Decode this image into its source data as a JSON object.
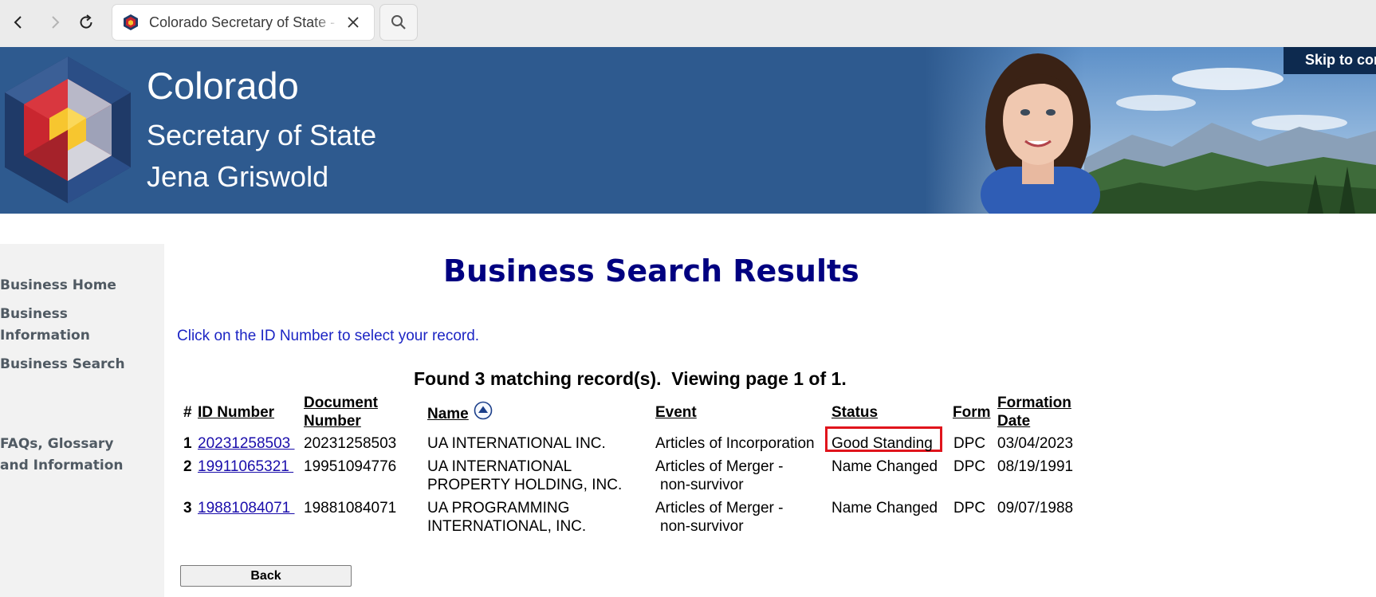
{
  "browser": {
    "tab_title": "Colorado Secretary of State - Business Search Results",
    "tab_favicon": "colorado-sos-favicon"
  },
  "banner": {
    "state": "Colorado",
    "office": "Secretary of State",
    "official": "Jena Griswold",
    "skip_link": "Skip to content",
    "colors": {
      "background": "#2e5a8f"
    }
  },
  "sidebar": {
    "items": [
      {
        "label": "Business Home"
      },
      {
        "label_line1": "Business",
        "label_line2": "Information"
      },
      {
        "label": "Business Search"
      },
      {
        "label_line1": "FAQs, Glossary",
        "label_line2": "and Information"
      }
    ]
  },
  "main": {
    "title": "Business Search Results",
    "instruction": "Click on the ID Number to select your record.",
    "summary": "Found 3 matching record(s).  Viewing page 1 of 1.",
    "table": {
      "headers": {
        "hash": "#",
        "id_number": "ID Number",
        "document_number_line1": "Document",
        "document_number_line2": "Number",
        "name": "Name",
        "event": "Event",
        "status": "Status",
        "form": "Form",
        "formation_date_line1": "Formation",
        "formation_date_line2": "Date"
      },
      "rows": [
        {
          "num": "1",
          "id": "20231258503",
          "doc": "20231258503",
          "name_line1": "UA INTERNATIONAL INC.",
          "name_line2": "",
          "event_line1": "Articles of Incorporation",
          "event_line2": "",
          "status": "Good Standing",
          "form": "DPC",
          "date": "03/04/2023"
        },
        {
          "num": "2",
          "id": "19911065321",
          "doc": "19951094776",
          "name_line1": "UA INTERNATIONAL",
          "name_line2": "PROPERTY HOLDING, INC.",
          "event_line1": "Articles of Merger -",
          "event_line2": "non-survivor",
          "status": "Name Changed",
          "form": "DPC",
          "date": "08/19/1991"
        },
        {
          "num": "3",
          "id": "19881084071",
          "doc": "19881084071",
          "name_line1": "UA PROGRAMMING",
          "name_line2": "INTERNATIONAL, INC.",
          "event_line1": "Articles of Merger -",
          "event_line2": "non-survivor",
          "status": "Name Changed",
          "form": "DPC",
          "date": "09/07/1988"
        }
      ],
      "highlight_color": "#e0141c"
    },
    "back_button": "Back"
  }
}
